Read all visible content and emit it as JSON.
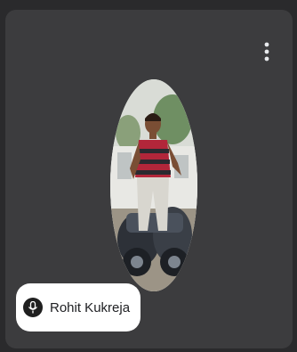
{
  "participant": {
    "name": "Rohit Kukreja"
  },
  "icons": {
    "menu": "more-options-icon",
    "mic": "mic-icon"
  },
  "colors": {
    "tile_background": "#3c3c3e",
    "page_background": "#2a2a2c",
    "chip_background": "#ffffff"
  }
}
